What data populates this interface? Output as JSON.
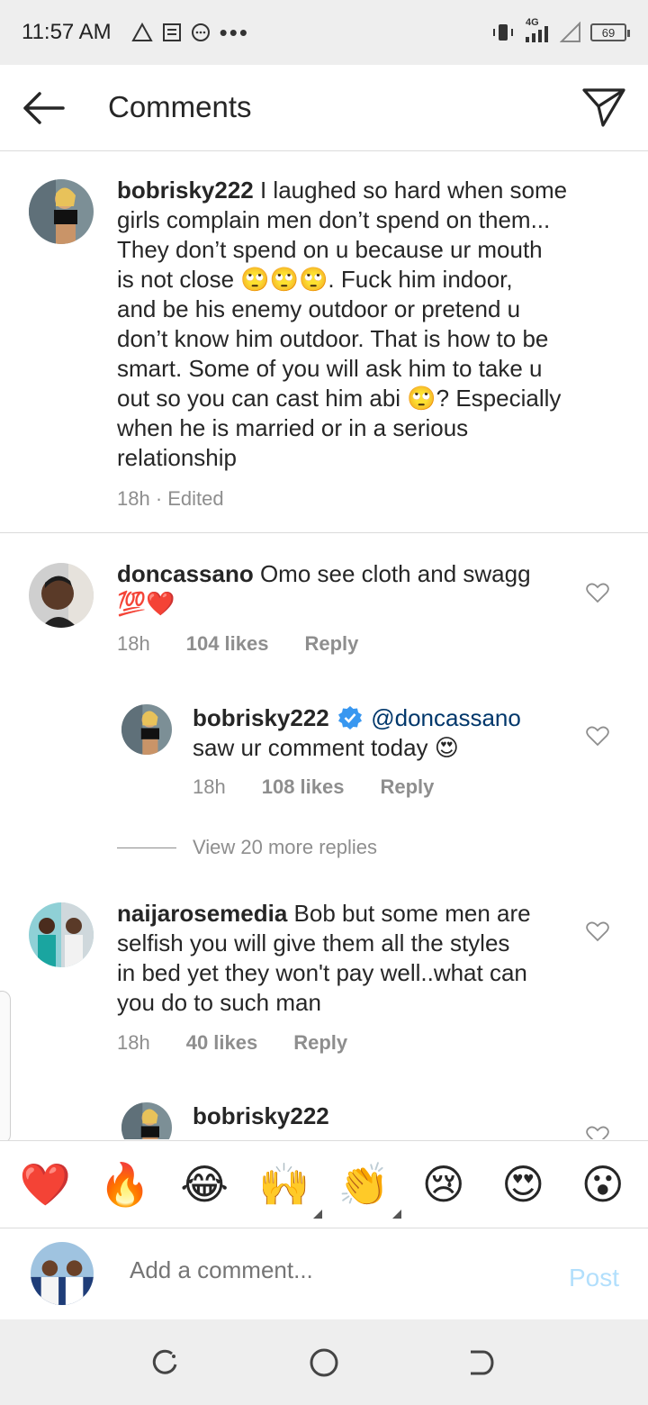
{
  "status": {
    "time": "11:57 AM",
    "network": "4G",
    "battery": "69"
  },
  "header": {
    "title": "Comments"
  },
  "comments": [
    {
      "username": "bobrisky222",
      "text_lines": [
        "I laughed so hard when some",
        "girls complain men don’t spend on them...",
        "They don’t spend on u because ur mouth",
        "is not close 🙄🙄🙄. Fuck him indoor,",
        "and be his enemy outdoor or pretend u",
        "don’t know him outdoor. That is how to be",
        "smart. Some of you will ask him to take u",
        "out so you can cast him abi 🙄? Especially",
        "when he is married or in a serious",
        "relationship"
      ],
      "time": "18h · Edited"
    },
    {
      "username": "doncassano",
      "text_lines": [
        "Omo see cloth and swagg",
        "💯❤️"
      ],
      "time": "18h",
      "likes": "104 likes",
      "reply": "Reply"
    },
    {
      "username": "bobrisky222",
      "mention": "@doncassano",
      "text_lines": [
        "saw ur comment today 😍"
      ],
      "time": "18h",
      "likes": "108 likes",
      "reply": "Reply"
    },
    {
      "username": "naijarosemedia",
      "text_lines": [
        "Bob but some men are",
        "selfish you will give them all the styles",
        "in bed yet they won't pay well..what can",
        "you do to such man"
      ],
      "time": "18h",
      "likes": "40 likes",
      "reply": "Reply"
    },
    {
      "username": "bobrisky222"
    }
  ],
  "view_more": "View 20 more replies",
  "emoji_bar": [
    "❤️",
    "🔥",
    "😂",
    "🙌",
    "👏",
    "😢",
    "😍",
    "😮"
  ],
  "composer": {
    "placeholder": "Add a comment...",
    "post_label": "Post"
  },
  "colors": {
    "mention": "#00376b",
    "post_disabled": "#b2dffc",
    "secondary_text": "#8e8e8e"
  }
}
